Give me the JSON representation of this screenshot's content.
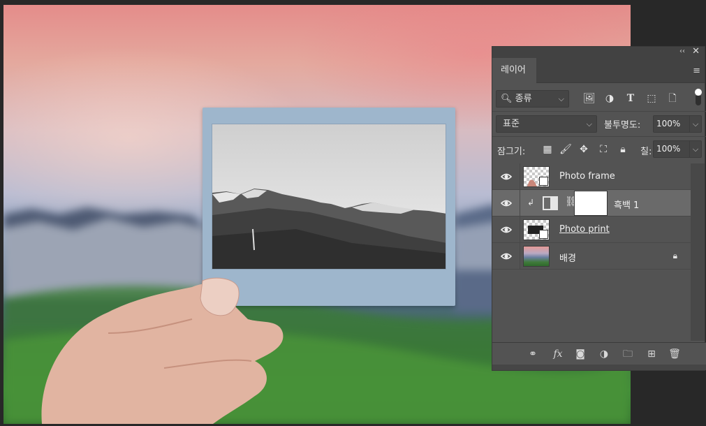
{
  "panel": {
    "tab_label": "레이어",
    "filter": {
      "kind_label": "종류",
      "icons": [
        "image-filter-icon",
        "adjustment-filter-icon",
        "type-filter-icon",
        "shape-filter-icon",
        "smart-object-filter-icon"
      ]
    },
    "blend_mode": "표준",
    "opacity_label": "불투명도:",
    "opacity_value": "100%",
    "lock_label": "잠그기:",
    "fill_label": "칠:",
    "fill_value": "100%",
    "layers": [
      {
        "name": "Photo frame",
        "visible": true,
        "type": "smart-object"
      },
      {
        "name": "흑백 1",
        "visible": true,
        "type": "adjustment",
        "selected": true,
        "clipped": true
      },
      {
        "name": "Photo print",
        "visible": true,
        "type": "smart-object"
      },
      {
        "name": "배경",
        "visible": true,
        "type": "background",
        "locked": true
      }
    ]
  },
  "colors": {
    "panel_bg": "#535353",
    "panel_header": "#424242",
    "selected_row": "#6a6a6a",
    "polaroid_frame": "#9eb6cc"
  }
}
